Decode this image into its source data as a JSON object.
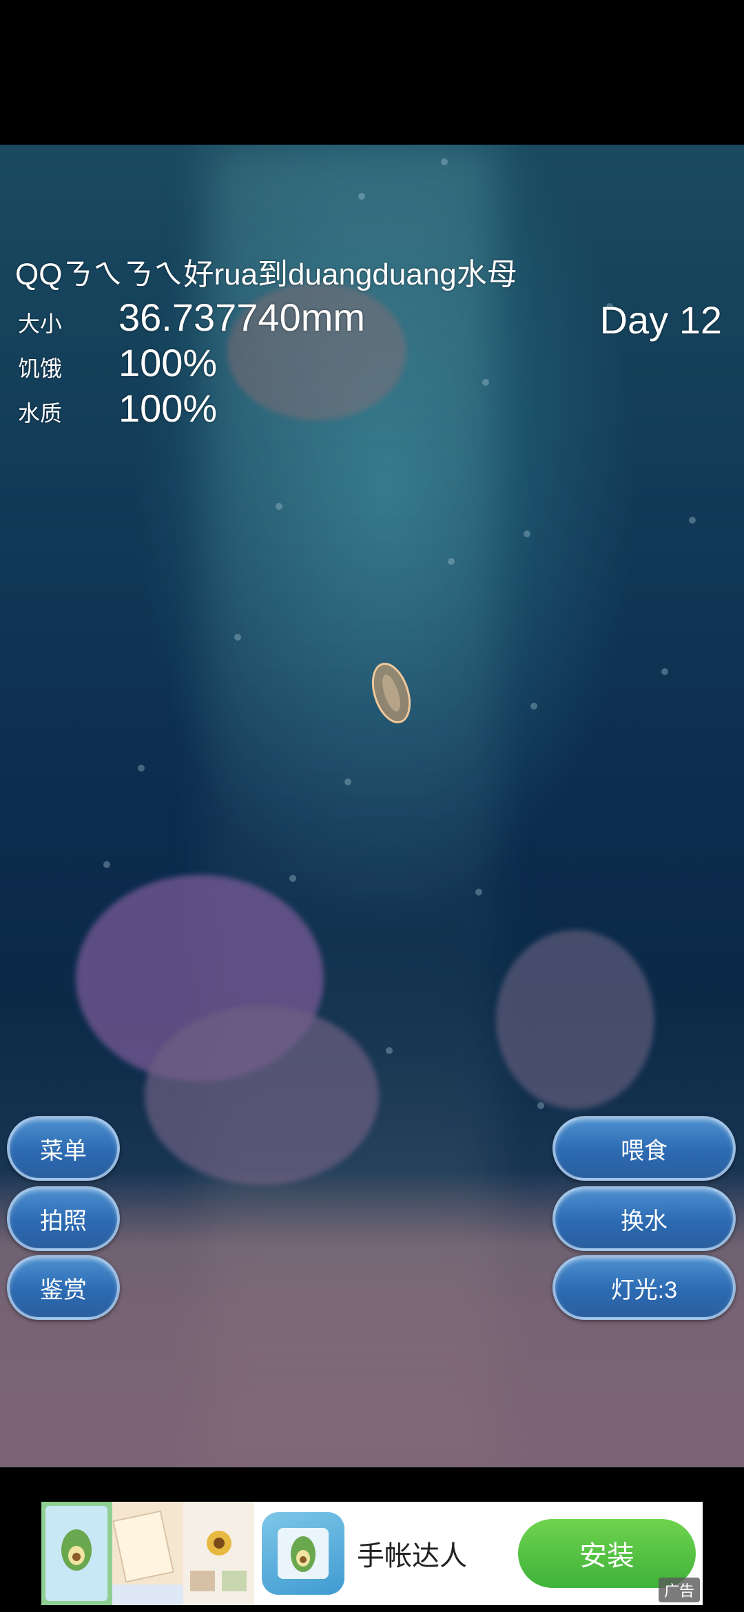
{
  "pet": {
    "name": "QQㄋㄟㄋㄟ好rua到duangduang水母",
    "day": "Day 12"
  },
  "stats": [
    {
      "label": "大小",
      "value": "36.737740mm"
    },
    {
      "label": "饥饿",
      "value": "100%"
    },
    {
      "label": "水质",
      "value": "100%"
    }
  ],
  "left_buttons": {
    "menu": "菜单",
    "photo": "拍照",
    "appreciate": "鉴赏"
  },
  "right_buttons": {
    "feed": "喂食",
    "change_water": "换水",
    "light": "灯光:3"
  },
  "ad": {
    "title": "手帐达人",
    "install": "安装",
    "tag": "广告"
  },
  "colors": {
    "button": "#3374bb",
    "install_green": "#4dc23d"
  }
}
